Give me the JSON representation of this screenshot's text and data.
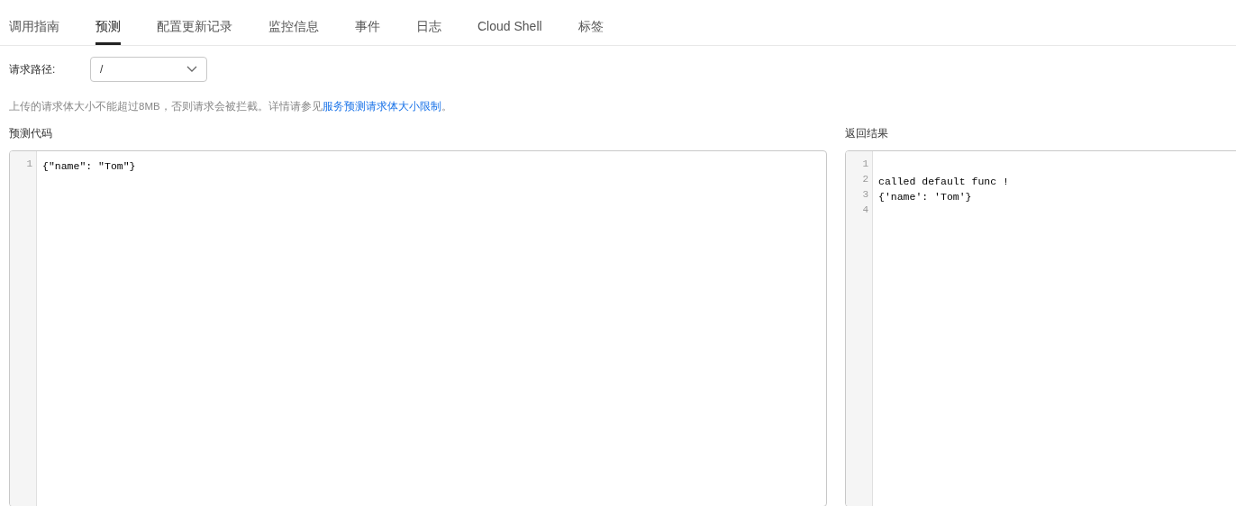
{
  "tabs": [
    {
      "label": "调用指南",
      "selected": false
    },
    {
      "label": "预测",
      "selected": true
    },
    {
      "label": "配置更新记录",
      "selected": false
    },
    {
      "label": "监控信息",
      "selected": false
    },
    {
      "label": "事件",
      "selected": false
    },
    {
      "label": "日志",
      "selected": false
    },
    {
      "label": "Cloud Shell",
      "selected": false
    },
    {
      "label": "标签",
      "selected": false
    }
  ],
  "request_path": {
    "label": "请求路径:",
    "value": "/"
  },
  "notice": {
    "text": "上传的请求体大小不能超过8MB，否则请求会被拦截。详情请参见",
    "link": "服务预测请求体大小限制",
    "end": "。"
  },
  "prediction_code": {
    "label": "预测代码",
    "lines": [
      {
        "number": "1",
        "text": "{\"name\": \"Tom\"}"
      }
    ]
  },
  "result": {
    "label": "返回结果",
    "lines": [
      {
        "number": "1"
      },
      {
        "number": "2",
        "text": "called default func !"
      },
      {
        "number": "3",
        "text": "{'name': 'Tom'}"
      },
      {
        "number": "4"
      }
    ]
  }
}
